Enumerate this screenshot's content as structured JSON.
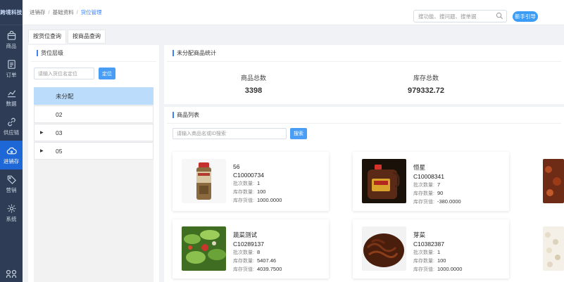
{
  "brand": "跨境科技",
  "nav": [
    {
      "label": "商品",
      "icon": "bag-icon"
    },
    {
      "label": "订单",
      "icon": "document-icon"
    },
    {
      "label": "数据",
      "icon": "chart-icon"
    },
    {
      "label": "供应链",
      "icon": "link-icon"
    },
    {
      "label": "进销存",
      "icon": "cloud-icon"
    },
    {
      "label": "营销",
      "icon": "tag-icon"
    },
    {
      "label": "系统",
      "icon": "gear-icon"
    }
  ],
  "breadcrumb": [
    "进销存",
    "基础资料",
    "货位管理"
  ],
  "header": {
    "search_placeholder": "搜功能、搜问题、搜单据",
    "guide_button": "新手引导"
  },
  "tabs": [
    "按货位查询",
    "按商品查询"
  ],
  "left_panel": {
    "title": "货位层级",
    "input_placeholder": "请输入货位名定位",
    "locate_button": "定位",
    "tree": [
      {
        "label": "未分配",
        "caret": ""
      },
      {
        "label": "02",
        "caret": ""
      },
      {
        "label": "03",
        "caret": "▶"
      },
      {
        "label": "05",
        "caret": "▶"
      }
    ]
  },
  "stats": {
    "title": "未分配商品统计",
    "total_goods_label": "商品总数",
    "total_goods_value": "3398",
    "total_stock_label": "库存总数",
    "total_stock_value": "979332.72"
  },
  "list": {
    "title": "商品列表",
    "search_placeholder": "请输入商品名或ID搜索",
    "search_button": "搜索",
    "batch_label": "批次数量:",
    "stock_label": "库存数量:",
    "value_label": "库存货值:",
    "products": [
      {
        "name": "56",
        "code": "C10000734",
        "batch": "1",
        "stock": "100",
        "value": "1000.0000"
      },
      {
        "name": "恒星",
        "code": "C10008341",
        "batch": "7",
        "stock": "90",
        "value": "-380.0000"
      },
      {
        "name": "蔬菜测试",
        "code": "C10289137",
        "batch": "8",
        "stock": "5407.46",
        "value": "4039.7500"
      },
      {
        "name": "芽菜",
        "code": "C10382387",
        "batch": "1",
        "stock": "100",
        "value": "1000.0000"
      }
    ]
  }
}
